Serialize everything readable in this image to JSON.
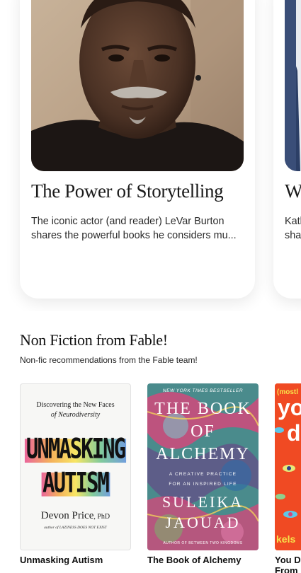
{
  "featured": [
    {
      "title": "The Power of Storytelling",
      "description": "The iconic actor (and reader) LeVar Burton shares the powerful books he considers mu..."
    },
    {
      "title": "Wh",
      "description": "Katl\nsha"
    }
  ],
  "section": {
    "title": "Non Fiction from Fable!",
    "subtitle": "Non-fic recommendations from the Fable team!"
  },
  "books": [
    {
      "title": "Unmasking Autism",
      "cover": {
        "top": "Discovering the New Faces",
        "top2": "of Neurodiversity",
        "word1": "UNMASKING",
        "word2": "AUTISM",
        "author": "Devon Price",
        "suffix": ", PhD",
        "byline": "author of LAZINESS DOES NOT EXIST"
      }
    },
    {
      "title": "The Book of Alchemy",
      "cover": {
        "banner": "NEW YORK TIMES BESTSELLER",
        "line1": "THE BOOK",
        "line2": "OF",
        "line3": "ALCHEMY",
        "tag1": "A CREATIVE PRACTICE",
        "tag2": "FOR AN INSPIRED LIFE",
        "author1": "SULEIKA",
        "author2": "JAOUAD",
        "byline": "AUTHOR OF BETWEEN TWO KINGDOMS"
      }
    },
    {
      "title": "You D\nFrom",
      "cover": {
        "top": "(mostl",
        "big1": "yo",
        "big2": "d",
        "author": "kels"
      }
    }
  ],
  "colors": {
    "alchemy_bg": "#4a8b8c",
    "alchemy_pink": "#d9457a",
    "orange_cover": "#f04a23"
  }
}
